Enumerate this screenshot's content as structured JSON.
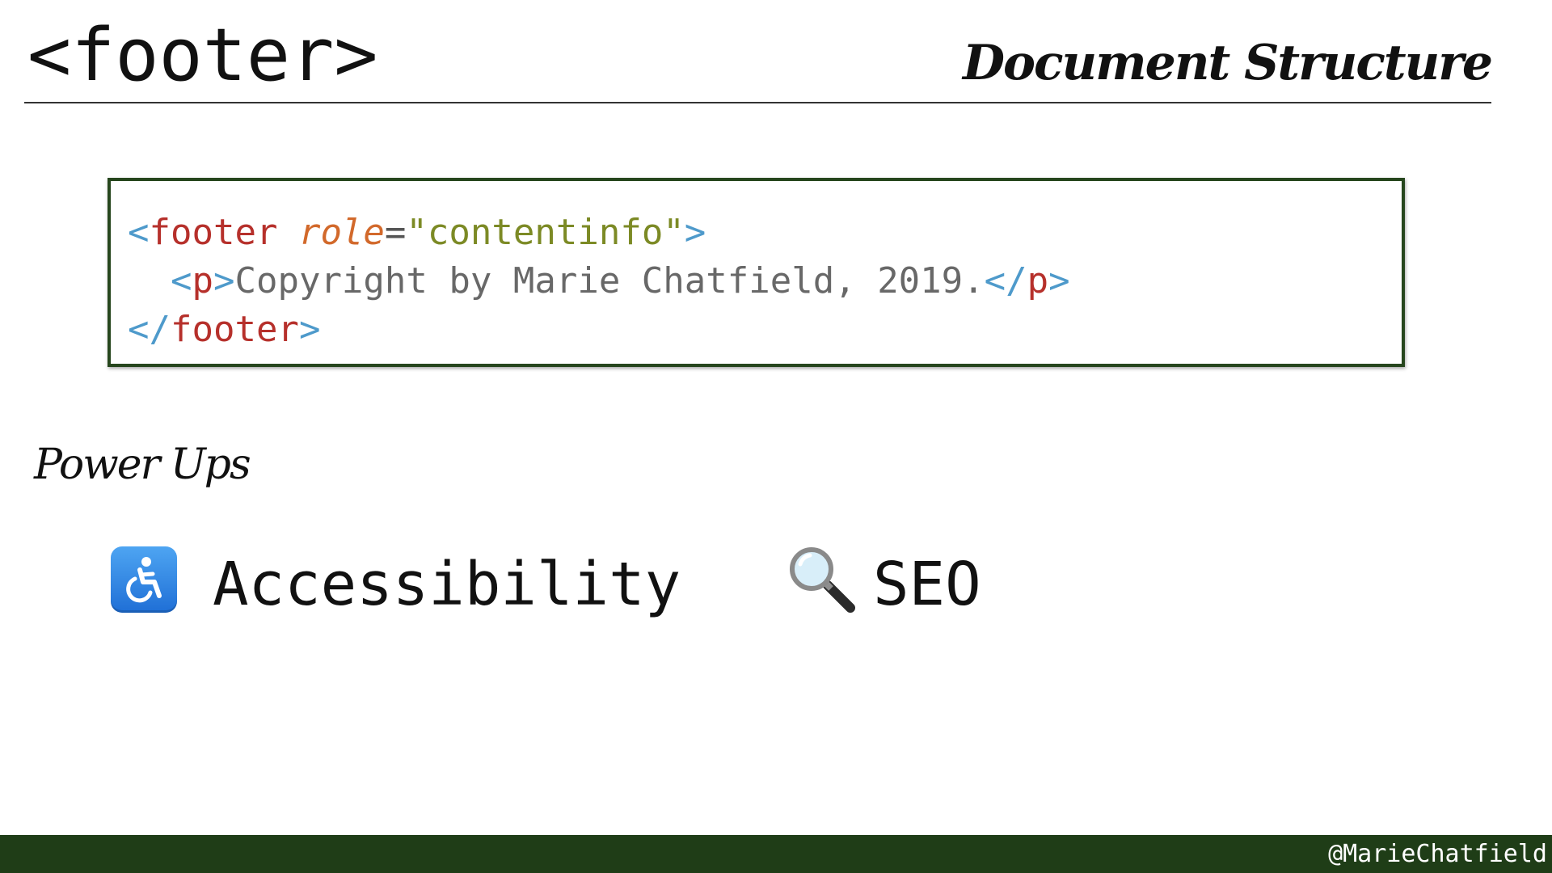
{
  "header": {
    "title": "<footer>",
    "section": "Document Structure"
  },
  "code": {
    "line1": {
      "open_bracket": "<",
      "tag": "footer",
      "space": " ",
      "attr": "role",
      "equals": "=",
      "value": "\"contentinfo\"",
      "close_bracket": ">"
    },
    "line2": {
      "indent": "  ",
      "open_bracket": "<",
      "tag": "p",
      "close_bracket": ">",
      "text": "Copyright by Marie Chatfield, 2019.",
      "end_open": "</",
      "end_tag": "p",
      "end_close": ">"
    },
    "line3": {
      "end_open": "</",
      "tag": "footer",
      "close_bracket": ">"
    }
  },
  "powerups": {
    "heading": "Power Ups",
    "items": [
      {
        "icon": "accessibility-icon",
        "label": "Accessibility"
      },
      {
        "icon": "magnifying-glass-icon",
        "label": "SEO"
      }
    ]
  },
  "footer": {
    "handle": "@MarieChatfield",
    "bar_color": "#1f3d17"
  },
  "colors": {
    "code_border": "#26461d",
    "punctuation": "#4e9acb",
    "tag": "#b6302b",
    "attribute": "#d2692b",
    "string": "#7c8a25",
    "text": "#686868"
  }
}
